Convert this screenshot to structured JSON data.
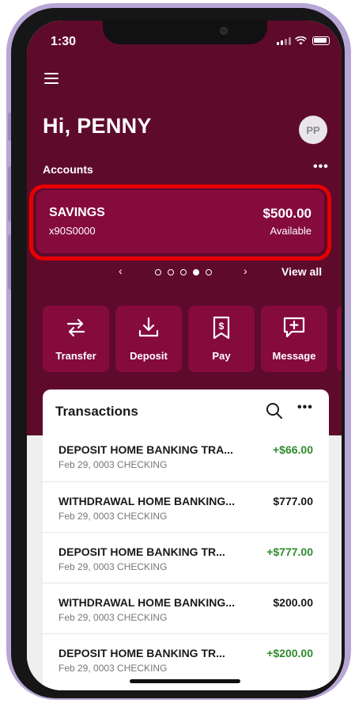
{
  "status_bar": {
    "time": "1:30"
  },
  "header": {
    "greeting": "Hi, PENNY",
    "avatar_initials": "PP",
    "accounts_label": "Accounts",
    "accounts_more": "•••"
  },
  "account": {
    "name": "SAVINGS",
    "number": "x90S0000",
    "balance": "$500.00",
    "balance_label": "Available"
  },
  "pager": {
    "prev": "‹",
    "next": "›",
    "dot_count": 5,
    "active_dot": 4,
    "view_all": "View all"
  },
  "actions": [
    {
      "label": "Transfer",
      "icon": "transfer-icon"
    },
    {
      "label": "Deposit",
      "icon": "deposit-icon"
    },
    {
      "label": "Pay",
      "icon": "pay-icon"
    },
    {
      "label": "Message",
      "icon": "message-icon"
    }
  ],
  "transactions": {
    "title": "Transactions",
    "more": "•••",
    "items": [
      {
        "desc": "DEPOSIT HOME BANKING TRA...",
        "sub": "Feb 29, 0003 CHECKING",
        "amount": "+$66.00",
        "type": "pos"
      },
      {
        "desc": "WITHDRAWAL HOME BANKING...",
        "sub": "Feb 29, 0003 CHECKING",
        "amount": "$777.00",
        "type": "neg"
      },
      {
        "desc": "DEPOSIT HOME BANKING TR...",
        "sub": "Feb 29, 0003 CHECKING",
        "amount": "+$777.00",
        "type": "pos"
      },
      {
        "desc": "WITHDRAWAL HOME BANKING...",
        "sub": "Feb 29, 0003 CHECKING",
        "amount": "$200.00",
        "type": "neg"
      },
      {
        "desc": "DEPOSIT HOME BANKING TR...",
        "sub": "Feb 29, 0003 CHECKING",
        "amount": "+$200.00",
        "type": "pos"
      }
    ]
  },
  "colors": {
    "brand": "#5e0a2b",
    "card": "#850b3d",
    "highlight": "#e60000",
    "positive": "#2e8b2e"
  }
}
